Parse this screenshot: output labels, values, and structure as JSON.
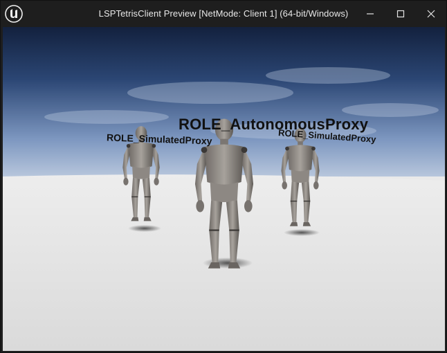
{
  "window": {
    "title": "LSPTetrisClient Preview [NetMode: Client 1]  (64-bit/Windows)",
    "logo_icon": "unreal-engine-logo-icon",
    "controls": [
      "minimize-icon",
      "maximize-icon",
      "close-icon"
    ]
  },
  "viewport": {
    "labels": {
      "autonomous": "ROLE_AutonomousProxy",
      "simulated_left": "ROLE_SimulatedProxy",
      "simulated_right": "ROLE_SimulatedProxy"
    },
    "colors": {
      "sky_top": "#1a2a4a",
      "sky_horizon": "#9fb3d1",
      "floor": "#e6e6e6",
      "mannequin": "#8a8580"
    }
  }
}
